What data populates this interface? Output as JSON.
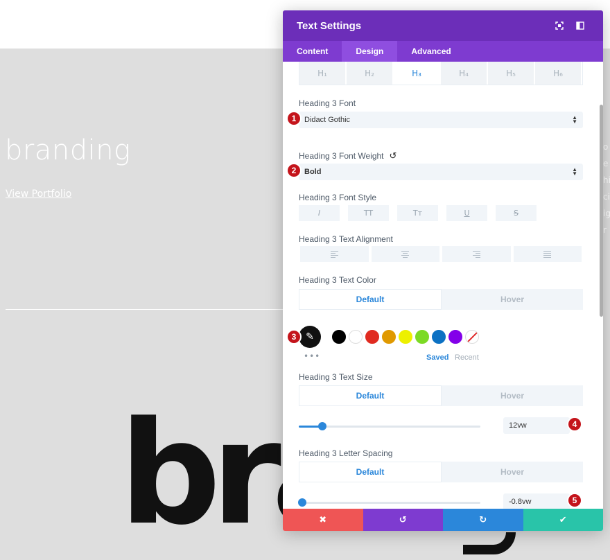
{
  "background": {
    "title": "branding",
    "link": "View Portfolio",
    "big_text": "bran",
    "right_letters": [
      "o",
      "e",
      "",
      "hi",
      "ci",
      "ig",
      "r"
    ]
  },
  "modal": {
    "title": "Text Settings",
    "header_icons": [
      "expand-icon",
      "sidebar-icon"
    ],
    "tabs": [
      {
        "label": "Content",
        "active": false
      },
      {
        "label": "Design",
        "active": true
      },
      {
        "label": "Advanced",
        "active": false
      }
    ],
    "heading_tabs": [
      "H₁",
      "H₂",
      "H₃",
      "H₄",
      "H₅",
      "H₆"
    ],
    "heading_tab_active": 2,
    "font": {
      "label": "Heading 3 Font",
      "value": "Didact Gothic"
    },
    "font_weight": {
      "label": "Heading 3 Font Weight",
      "value": "Bold"
    },
    "font_style": {
      "label": "Heading 3 Font Style",
      "buttons": [
        "I",
        "TT",
        "Tт",
        "U",
        "S"
      ]
    },
    "text_alignment": {
      "label": "Heading 3 Text Alignment"
    },
    "text_color": {
      "label": "Heading 3 Text Color",
      "tabs": [
        "Default",
        "Hover"
      ],
      "swatches": [
        "#000000",
        "#ffffff",
        "#e02b20",
        "#e09900",
        "#edf000",
        "#7cda24",
        "#0c71c3",
        "#8300e9"
      ],
      "more": "•••",
      "saved": "Saved",
      "recent": "Recent"
    },
    "text_size": {
      "label": "Heading 3 Text Size",
      "tabs": [
        "Default",
        "Hover"
      ],
      "value": "12vw",
      "slider_fraction": 0.13
    },
    "letter_spacing": {
      "label": "Heading 3 Letter Spacing",
      "tabs": [
        "Default",
        "Hover"
      ],
      "value": "-0.8vw",
      "slider_fraction": 0.02
    },
    "badges": [
      "1",
      "2",
      "3",
      "4",
      "5"
    ],
    "footer": {
      "cancel": "✖",
      "undo": "↺",
      "redo": "↻",
      "save": "✔",
      "colors": [
        "#ef5555",
        "#7e3bd0",
        "#2b87da",
        "#29c4a9"
      ]
    }
  }
}
